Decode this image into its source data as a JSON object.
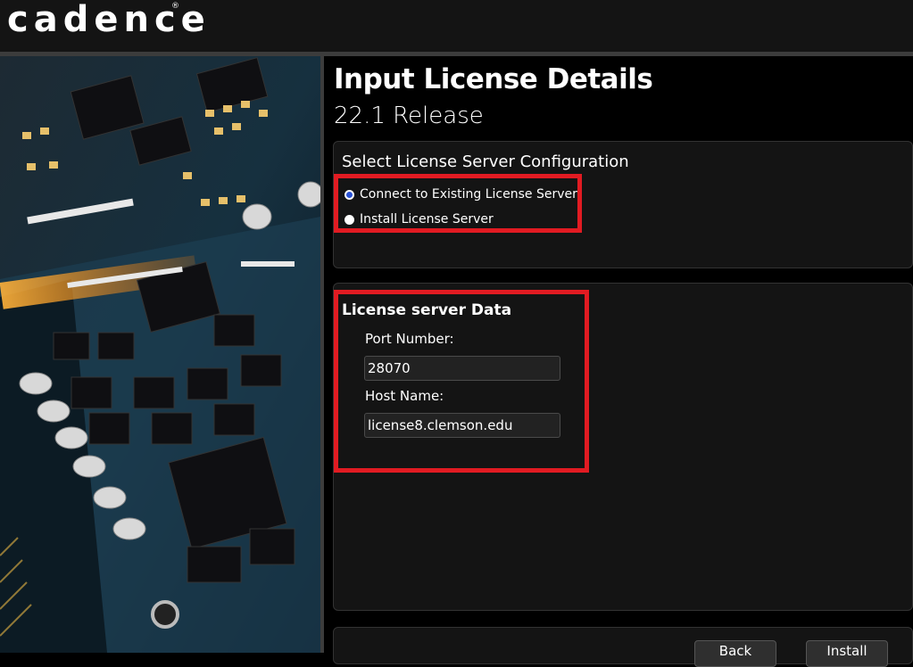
{
  "brand": {
    "logo_text": "cadence",
    "registered": "®"
  },
  "page": {
    "title": "Input License Details",
    "subtitle": "22.1 Release"
  },
  "config": {
    "title": "Select License Server Configuration",
    "options": [
      {
        "label": "Connect to Existing License Server",
        "selected": true
      },
      {
        "label": "Install License Server",
        "selected": false
      }
    ]
  },
  "server": {
    "title": "License server Data",
    "port_label": "Port Number:",
    "port_value": "28070",
    "host_label": "Host Name:",
    "host_value": "license8.clemson.edu"
  },
  "footer": {
    "back_label": "Back",
    "install_label": "Install"
  },
  "colors": {
    "highlight": "#e11b22",
    "radio_selected": "#2952d6",
    "panel": "#141414"
  }
}
